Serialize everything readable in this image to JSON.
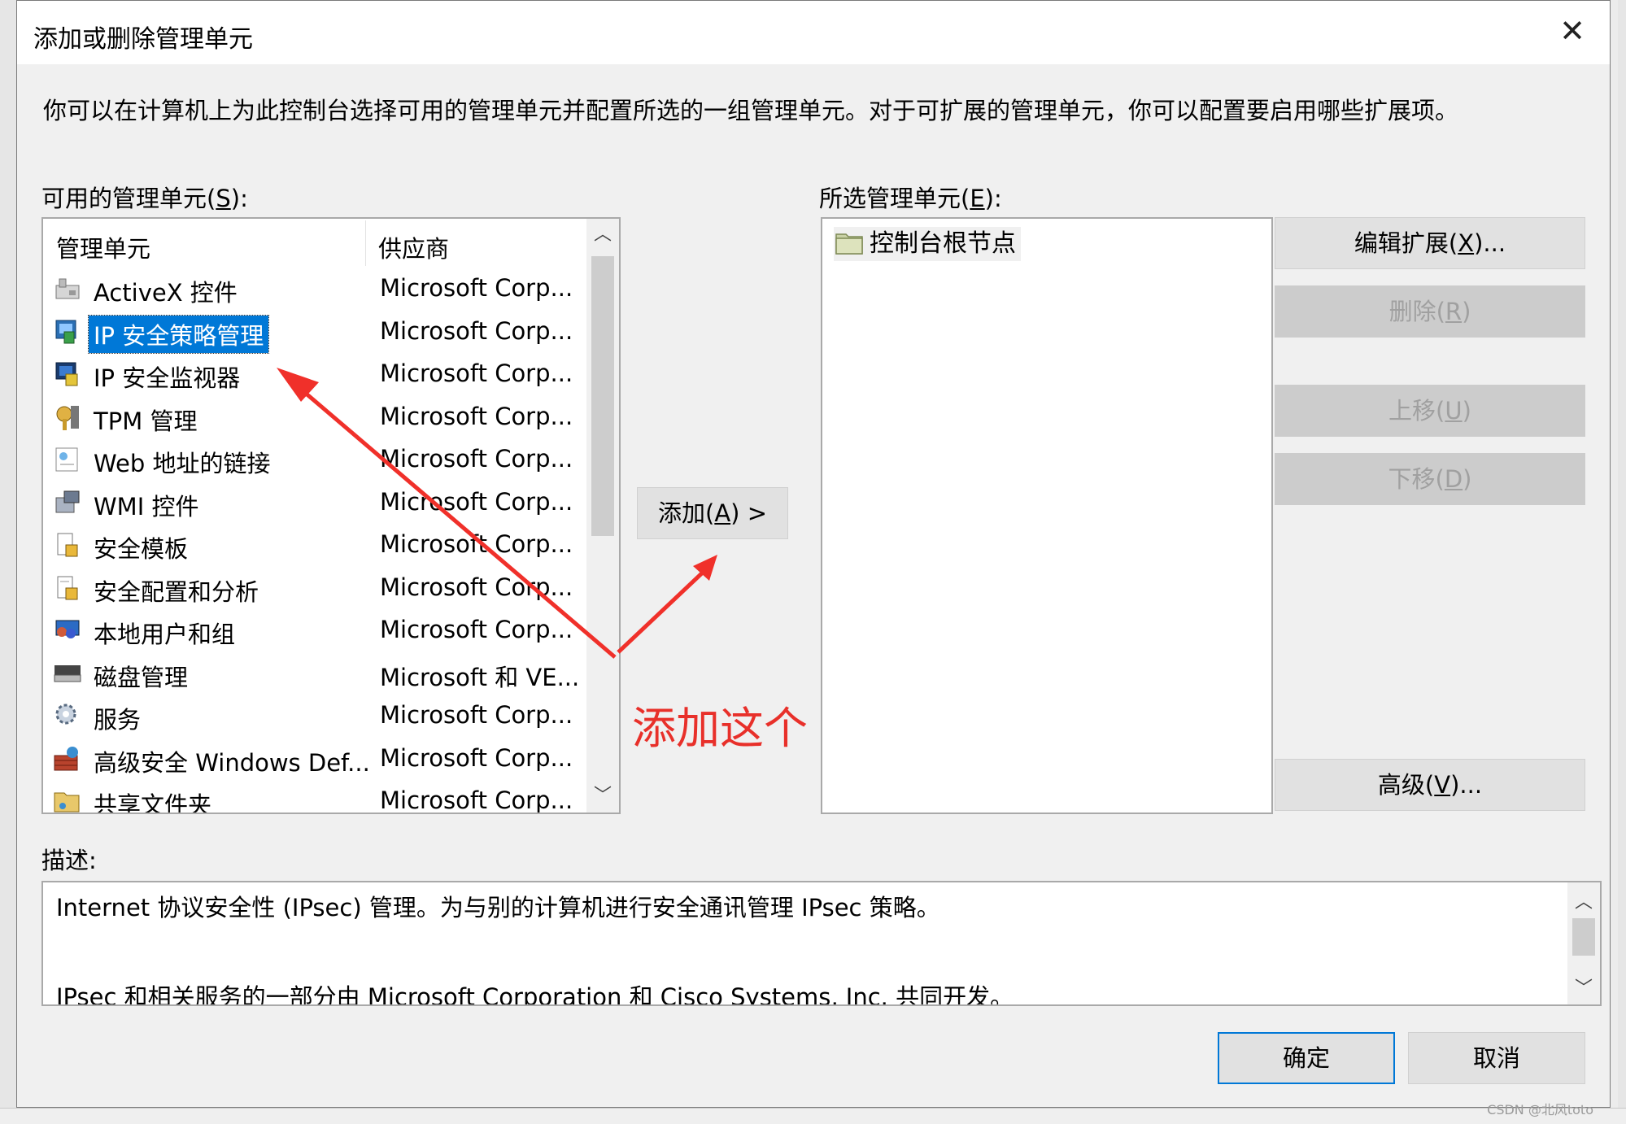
{
  "dialog": {
    "title": "添加或删除管理单元",
    "close_glyph": "✕",
    "intro": "你可以在计算机上为此控制台选择可用的管理单元并配置所选的一组管理单元。对于可扩展的管理单元，你可以配置要启用哪些扩展项。"
  },
  "available": {
    "label_pre": "可用的管理单元(",
    "label_key": "S",
    "label_post": "):",
    "col_name": "管理单元",
    "col_vendor": "供应商",
    "items": [
      {
        "name": "ActiveX 控件",
        "vendor": "Microsoft Corp...",
        "icon": "activex-icon"
      },
      {
        "name": "IP 安全策略管理",
        "vendor": "Microsoft Corp...",
        "icon": "ip-security-policy-icon"
      },
      {
        "name": "IP 安全监视器",
        "vendor": "Microsoft Corp...",
        "icon": "ip-security-monitor-icon"
      },
      {
        "name": "TPM 管理",
        "vendor": "Microsoft Corp...",
        "icon": "tpm-key-icon"
      },
      {
        "name": "Web 地址的链接",
        "vendor": "Microsoft Corp...",
        "icon": "web-link-icon"
      },
      {
        "name": "WMI 控件",
        "vendor": "Microsoft Corp...",
        "icon": "wmi-icon"
      },
      {
        "name": "安全模板",
        "vendor": "Microsoft Corp...",
        "icon": "security-template-icon"
      },
      {
        "name": "安全配置和分析",
        "vendor": "Microsoft Corp...",
        "icon": "security-analysis-icon"
      },
      {
        "name": "本地用户和组",
        "vendor": "Microsoft Corp...",
        "icon": "local-users-icon"
      },
      {
        "name": "磁盘管理",
        "vendor": "Microsoft 和 VE...",
        "icon": "disk-icon"
      },
      {
        "name": "服务",
        "vendor": "Microsoft Corp...",
        "icon": "services-gear-icon"
      },
      {
        "name": "高级安全 Windows Def...",
        "vendor": "Microsoft Corp...",
        "icon": "firewall-icon"
      },
      {
        "name": "共享文件夹",
        "vendor": "Microsoft Corp...",
        "icon": "shared-folder-icon"
      }
    ],
    "selected_index": 1
  },
  "add_button": {
    "pre": "添加(",
    "key": "A",
    "post": ") >"
  },
  "selected": {
    "label_pre": "所选管理单元(",
    "label_key": "E",
    "label_post": "):",
    "items": [
      {
        "name": "控制台根节点",
        "icon": "folder-icon"
      }
    ]
  },
  "side_buttons": {
    "edit_ext": {
      "pre": "编辑扩展(",
      "key": "X",
      "post": ")..."
    },
    "remove": {
      "pre": "删除(",
      "key": "R",
      "post": ")"
    },
    "move_up": {
      "pre": "上移(",
      "key": "U",
      "post": ")"
    },
    "move_down": {
      "pre": "下移(",
      "key": "D",
      "post": ")"
    },
    "advanced": {
      "pre": "高级(",
      "key": "V",
      "post": ")..."
    }
  },
  "description": {
    "label": "描述:",
    "line1": "Internet 协议安全性 (IPsec) 管理。为与别的计算机进行安全通讯管理 IPsec 策略。",
    "line2": "IPsec 和相关服务的一部分由 Microsoft Corporation 和 Cisco Systems, Inc. 共同开发。"
  },
  "footer": {
    "ok": "确定",
    "cancel": "取消"
  },
  "annotation": {
    "text": "添加这个",
    "color": "#e8302a"
  },
  "watermark": "CSDN @北风toto",
  "colors": {
    "selection": "#0078d7",
    "default_border": "#0078d7",
    "disabled_text": "#a0a0a0"
  }
}
